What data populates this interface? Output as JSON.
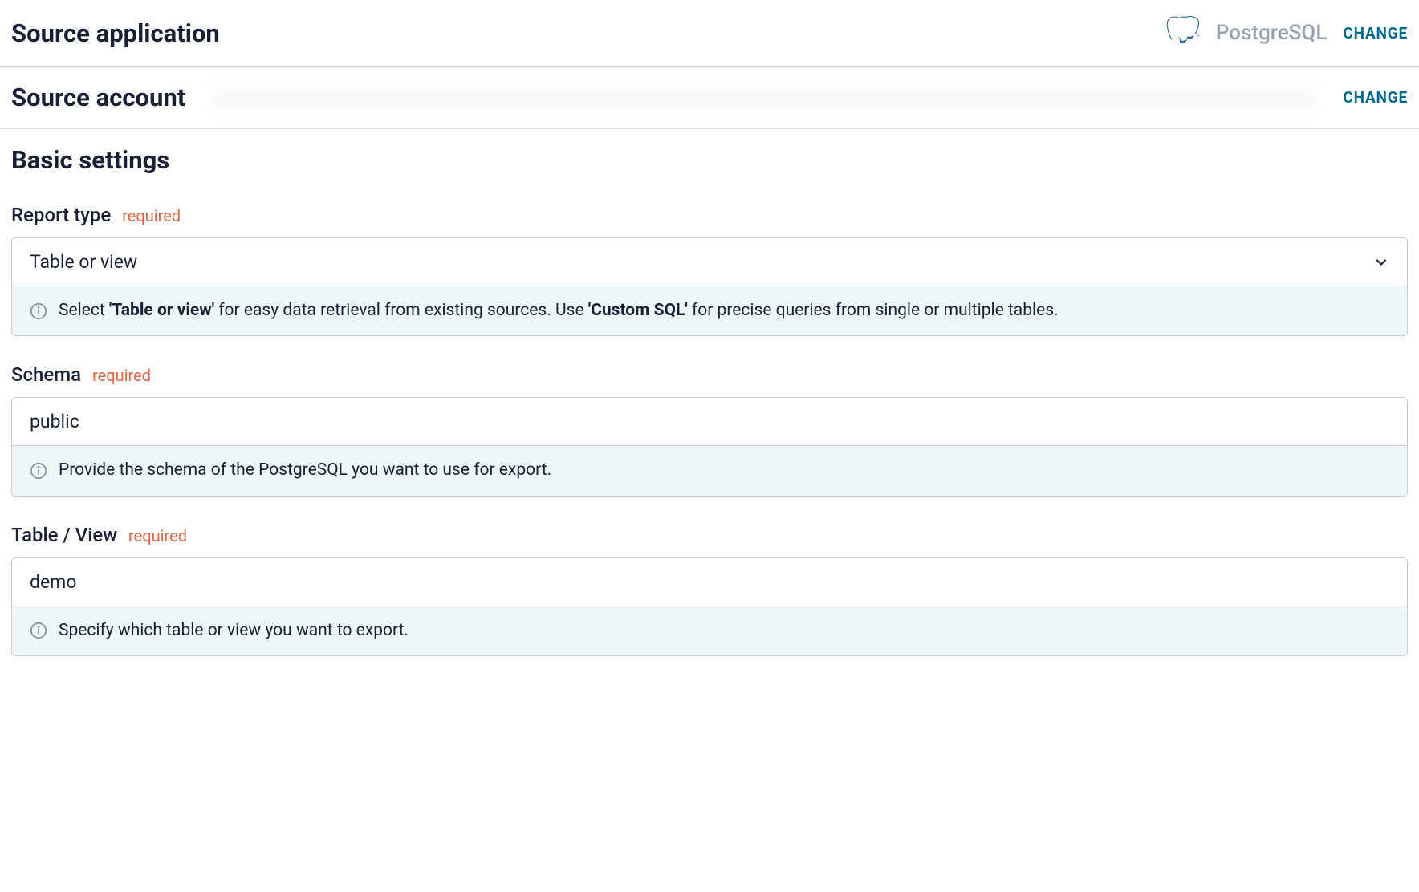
{
  "source_application": {
    "title": "Source application",
    "app_name": "PostgreSQL",
    "change_label": "CHANGE"
  },
  "source_account": {
    "title": "Source account",
    "change_label": "CHANGE"
  },
  "basic_settings": {
    "title": "Basic settings",
    "fields": {
      "report_type": {
        "label": "Report type",
        "required_tag": "required",
        "value": "Table or view",
        "hint_prefix": "Select ",
        "hint_bold1": "'Table or view'",
        "hint_mid": " for easy data retrieval from existing sources. Use ",
        "hint_bold2": "'Custom SQL'",
        "hint_suffix": " for precise queries from single or multiple tables."
      },
      "schema": {
        "label": "Schema",
        "required_tag": "required",
        "value": "public",
        "hint": "Provide the schema of the PostgreSQL you want to use for export."
      },
      "table_view": {
        "label": "Table / View",
        "required_tag": "required",
        "value": "demo",
        "hint": "Specify which table or view you want to export."
      }
    }
  }
}
